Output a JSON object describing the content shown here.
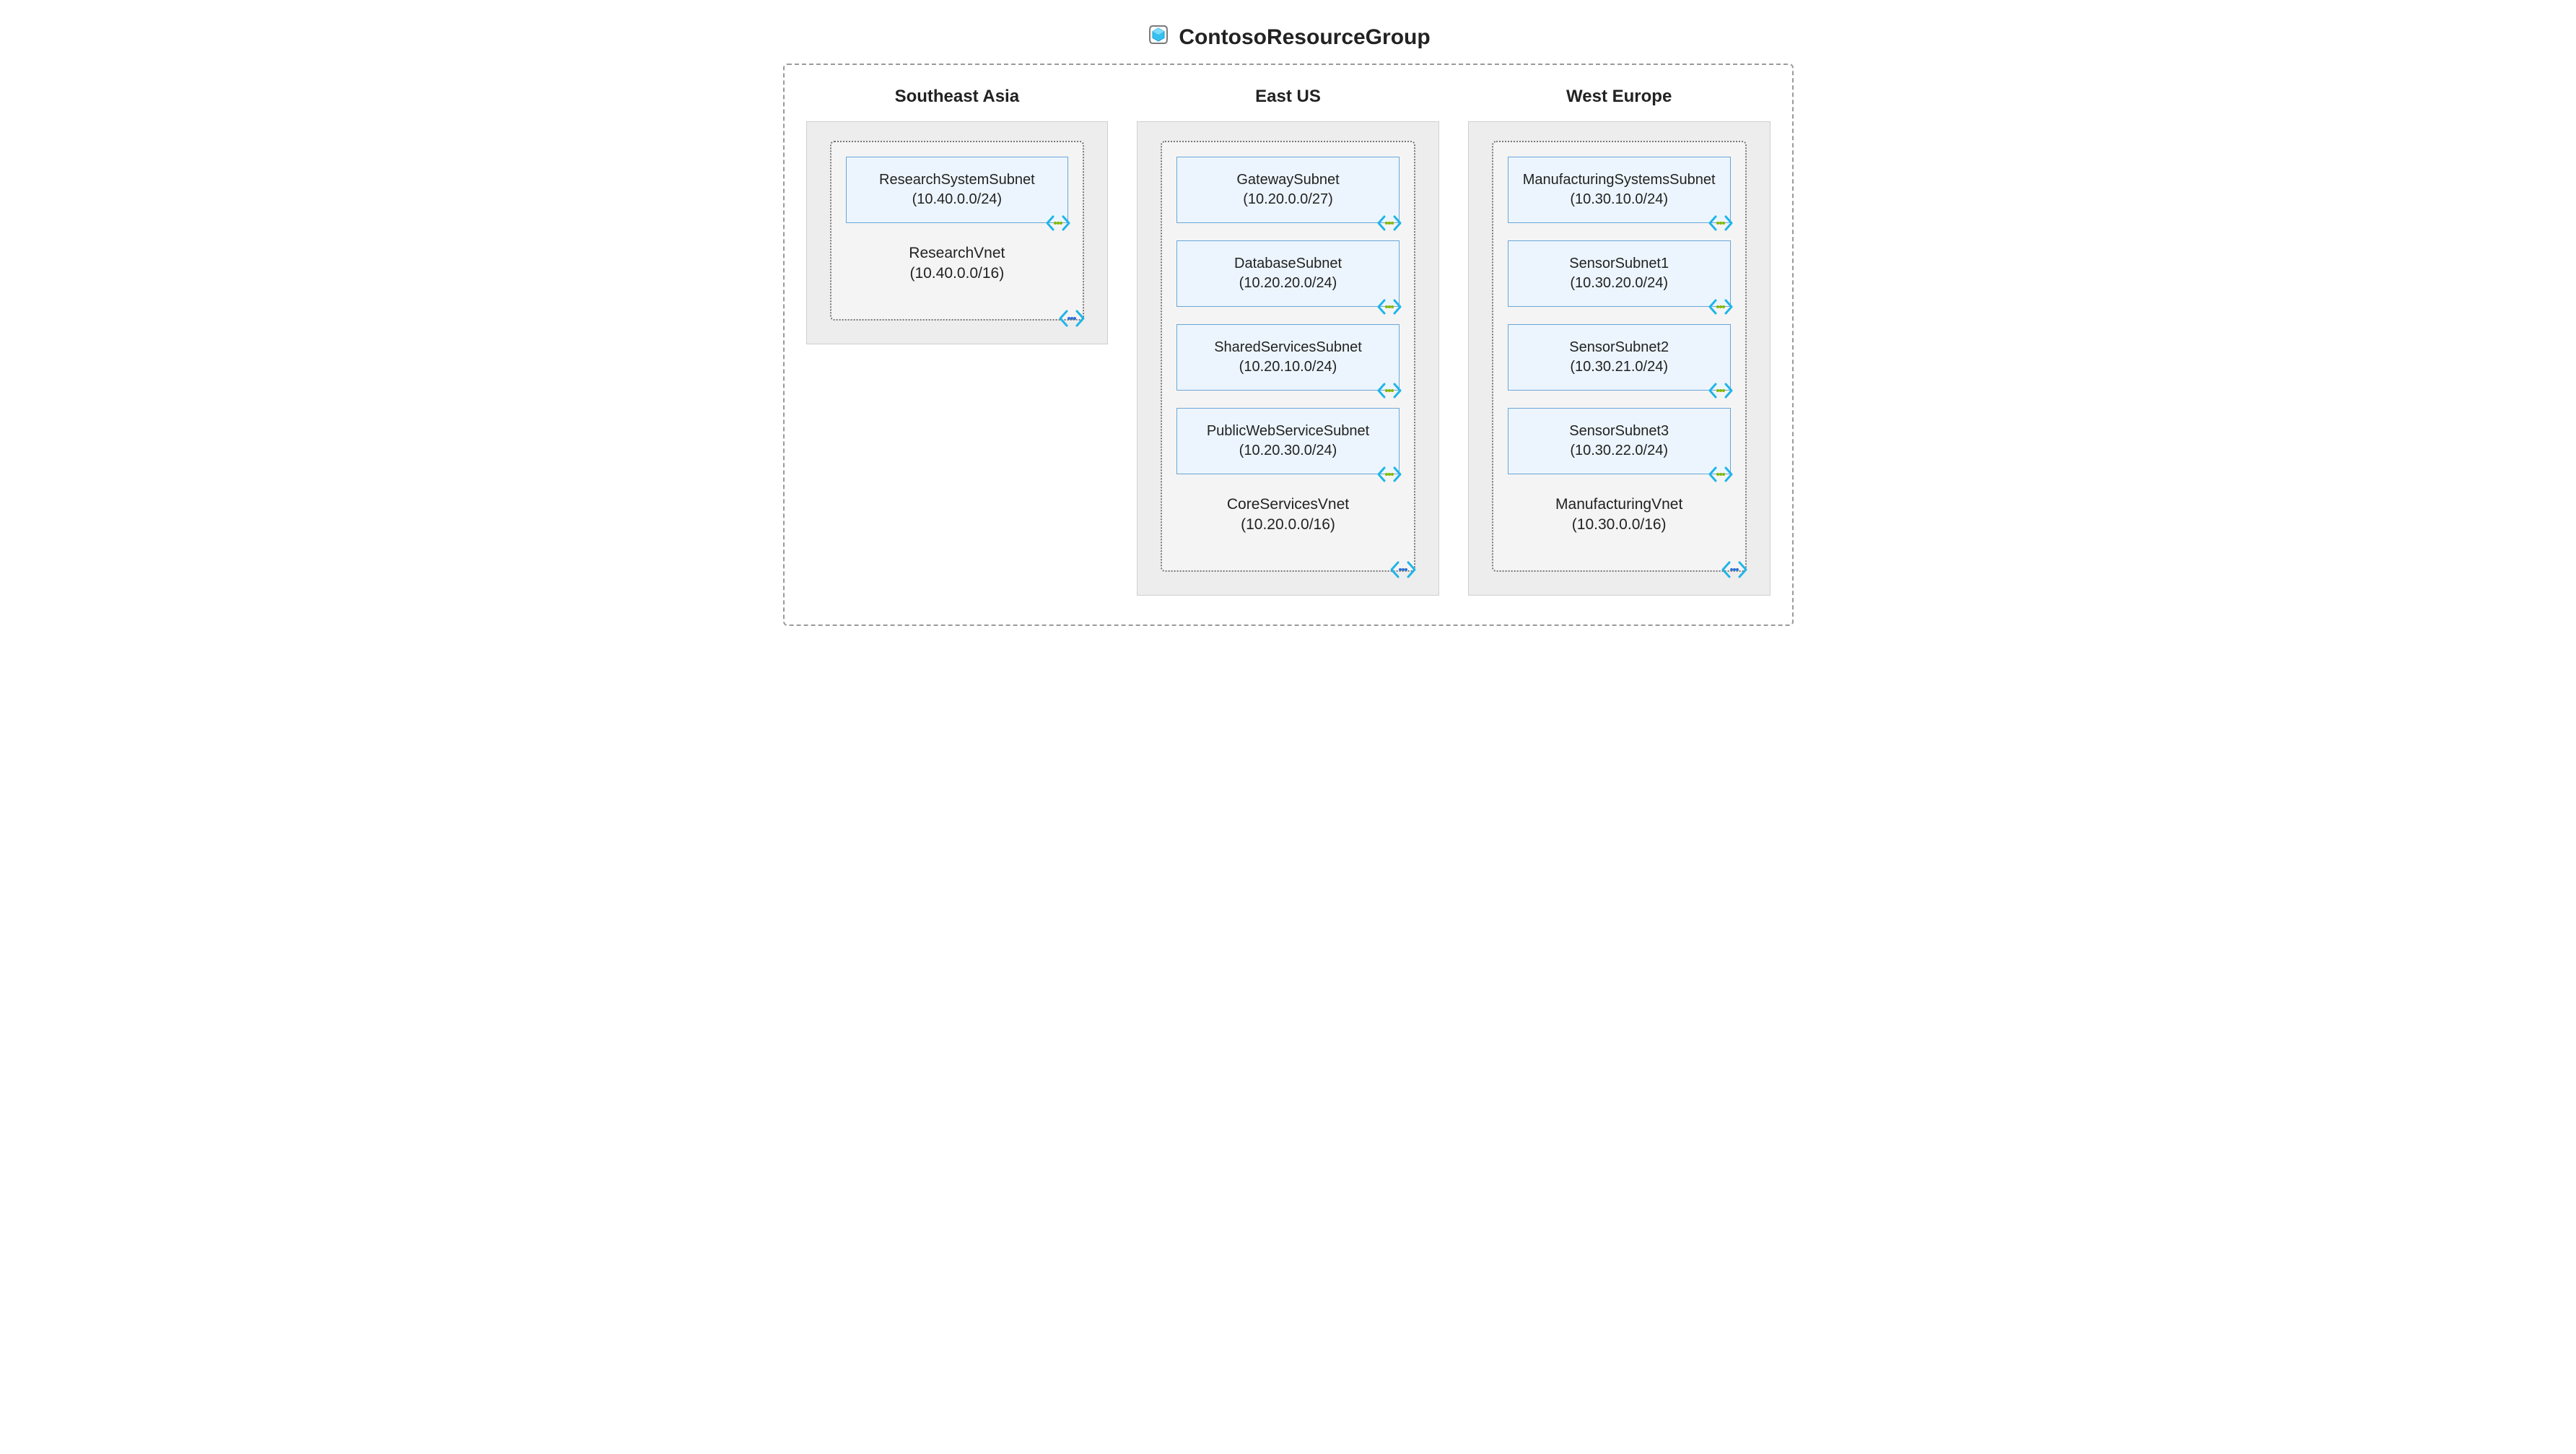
{
  "resourceGroup": {
    "name": "ContosoResourceGroup"
  },
  "regions": [
    {
      "title": "Southeast Asia",
      "vnet": {
        "name": "ResearchVnet",
        "cidr": "(10.40.0.0/16)"
      },
      "subnets": [
        {
          "name": "ResearchSystemSubnet",
          "cidr": "(10.40.0.0/24)"
        }
      ]
    },
    {
      "title": "East US",
      "vnet": {
        "name": "CoreServicesVnet",
        "cidr": "(10.20.0.0/16)"
      },
      "subnets": [
        {
          "name": "GatewaySubnet",
          "cidr": "(10.20.0.0/27)"
        },
        {
          "name": "DatabaseSubnet",
          "cidr": "(10.20.20.0/24)"
        },
        {
          "name": "SharedServicesSubnet",
          "cidr": "(10.20.10.0/24)"
        },
        {
          "name": "PublicWebServiceSubnet",
          "cidr": "(10.20.30.0/24)"
        }
      ]
    },
    {
      "title": "West Europe",
      "vnet": {
        "name": "ManufacturingVnet",
        "cidr": "(10.30.0.0/16)"
      },
      "subnets": [
        {
          "name": "ManufacturingSystemsSubnet",
          "cidr": "(10.30.10.0/24)"
        },
        {
          "name": "SensorSubnet1",
          "cidr": "(10.30.20.0/24)"
        },
        {
          "name": "SensorSubnet2",
          "cidr": "(10.30.21.0/24)"
        },
        {
          "name": "SensorSubnet3",
          "cidr": "(10.30.22.0/24)"
        }
      ]
    }
  ]
}
